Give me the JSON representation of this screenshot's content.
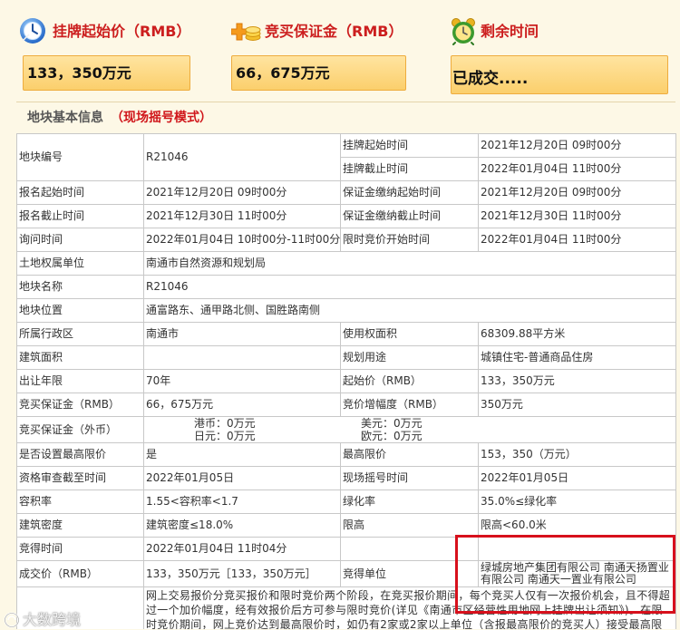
{
  "header": {
    "start_price": {
      "icon": "stopwatch-icon",
      "label": "挂牌起始价（RMB）",
      "value": "133，350万元"
    },
    "deposit": {
      "icon": "coins-icon",
      "label": "竞买保证金（RMB）",
      "value": "66，675万元"
    },
    "remaining_time": {
      "icon": "alarm-clock-icon",
      "label": "剩余时间",
      "value": "已成交....."
    }
  },
  "section": {
    "title": "地块基本信息",
    "mode": "（现场摇号模式）"
  },
  "fields": {
    "parcel_code": {
      "label": "地块编号",
      "value": "R21046"
    },
    "listing_start": {
      "label": "挂牌起始时间",
      "value": "2021年12月20日 09时00分"
    },
    "listing_end": {
      "label": "挂牌截止时间",
      "value": "2022年01月04日 11时00分"
    },
    "registration_start": {
      "label": "报名起始时间",
      "value": "2021年12月20日 09时00分"
    },
    "deposit_start": {
      "label": "保证金缴纳起始时间",
      "value": "2021年12月20日 09时00分"
    },
    "registration_end": {
      "label": "报名截止时间",
      "value": "2021年12月30日 11时00分"
    },
    "deposit_end": {
      "label": "保证金缴纳截止时间",
      "value": "2021年12月30日 11时00分"
    },
    "inquiry_time": {
      "label": "询问时间",
      "value": "2022年01月04日 10时00分-11时00分"
    },
    "timed_bidding_start": {
      "label": "限时竞价开始时间",
      "value": "2022年01月04日 11时00分"
    },
    "land_owner": {
      "label": "土地权属单位",
      "value": "南通市自然资源和规划局"
    },
    "parcel_name": {
      "label": "地块名称",
      "value": "R21046"
    },
    "location": {
      "label": "地块位置",
      "value": "通富路东、通甲路北侧、国胜路南侧"
    },
    "district": {
      "label": "所属行政区",
      "value": "南通市"
    },
    "use_area": {
      "label": "使用权面积",
      "value": "68309.88平方米"
    },
    "building_area": {
      "label": "建筑面积"
    },
    "planned_use": {
      "label": "规划用途",
      "value": "城镇住宅-普通商品住房"
    },
    "term": {
      "label": "出让年限",
      "value": "70年"
    },
    "start_price": {
      "label": "起始价（RMB）",
      "value": "133，350万元"
    },
    "deposit_rmb": {
      "label": "竞买保证金（RMB）",
      "value": "66，675万元"
    },
    "bid_increment": {
      "label": "竞价增幅度（RMB）",
      "value": "350万元"
    },
    "deposit_foreign": {
      "label": "竞买保证金（外币）",
      "hkd": "港币：0万元",
      "usd": "美元：0万元",
      "jpy": "日元：0万元",
      "eur": "欧元：0万元"
    },
    "has_price_cap": {
      "label": "是否设置最高限价",
      "value": "是"
    },
    "price_cap": {
      "label": "最高限价",
      "value": "153，350（万元）"
    },
    "qualification_deadline": {
      "label": "资格审查截至时间",
      "value": "2022年01月05日"
    },
    "lottery_time": {
      "label": "现场摇号时间",
      "value": "2022年01月05日"
    },
    "plot_ratio": {
      "label": "容积率",
      "value": "1.55<容积率<1.7"
    },
    "green_ratio": {
      "label": "绿化率",
      "value": "35.0%≤绿化率"
    },
    "building_density": {
      "label": "建筑密度",
      "value": "建筑密度≤18.0%"
    },
    "height_limit": {
      "label": "限高",
      "value": "限高<60.0米"
    },
    "winning_time": {
      "label": "竞得时间",
      "value": "2022年01月04日 11时04分"
    },
    "deal_price": {
      "label": "成交价（RMB）",
      "value": "133，350万元［133，350万元］"
    },
    "winner": {
      "label": "竞得单位",
      "value": "绿城房地产集团有限公司 南通天扬置业有限公司 南通天一置业有限公司"
    },
    "notice": {
      "value": "网上交易报价分竞买报价和限时竞价两个阶段，在竞买报价期间，每个竞买人仅有一次报价机会，且不得超过一个加价幅度，经有效报价后方可参与限时竞价(详见《南通市区经营性用地网上挂牌出让须知》)。在限时竞价期间，网上竞价达到最高限价时，如仍有2家或2家以上单位（含报最高限价的竞买人）接受最高限价，并要"
    }
  },
  "watermark": {
    "icon": "watermark-logo-icon",
    "text": "大数跨境"
  },
  "colors": {
    "page_background": "#fdf8e6",
    "header_label": "#cc1e1e",
    "value_box_fill": "#fbcf6c",
    "value_box_border": "#eeac3e",
    "mode_text": "#d0161b",
    "table_border": "#c8c8c8",
    "annotation_box": "#d7101c"
  }
}
